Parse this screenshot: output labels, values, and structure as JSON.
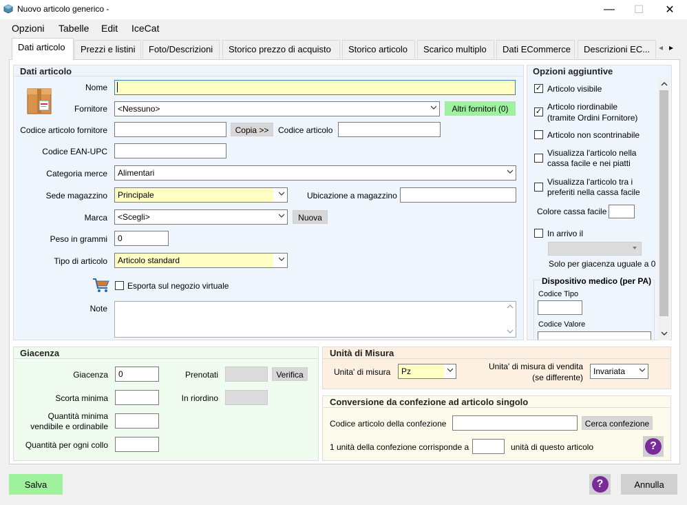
{
  "window": {
    "title": "Nuovo articolo generico -",
    "minimize": "—",
    "maximize": "☐",
    "close": "✕"
  },
  "menu": [
    "Opzioni",
    "Tabelle",
    "Edit",
    "IceCat"
  ],
  "tabs": [
    "Dati articolo",
    "Prezzi e listini",
    "Foto/Descrizioni",
    "Storico prezzo di acquisto",
    "Storico articolo",
    "Scarico multiplo",
    "Dati ECommerce",
    "Descrizioni EC..."
  ],
  "tab_scroll": {
    "left": "◂",
    "right": "▸"
  },
  "dati": {
    "title": "Dati articolo",
    "nome_label": "Nome",
    "nome_value": "",
    "fornitore_label": "Fornitore",
    "fornitore_value": "<Nessuno>",
    "altri_fornitori": "Altri fornitori (0)",
    "codice_fornitore_label": "Codice articolo fornitore",
    "codice_fornitore_value": "",
    "copia": "Copia >>",
    "codice_articolo_label": "Codice articolo",
    "codice_articolo_value": "",
    "ean_label": "Codice EAN-UPC",
    "ean_value": "",
    "categoria_label": "Categoria merce",
    "categoria_value": "Alimentari",
    "sede_label": "Sede magazzino",
    "sede_value": "Principale",
    "ubicazione_label": "Ubicazione a magazzino",
    "ubicazione_value": "",
    "marca_label": "Marca",
    "marca_value": "<Scegli>",
    "nuova": "Nuova",
    "peso_label": "Peso in grammi",
    "peso_value": "0",
    "tipo_label": "Tipo di articolo",
    "tipo_value": "Articolo standard",
    "esporta_label": "Esporta sul negozio virtuale",
    "note_label": "Note",
    "note_value": ""
  },
  "opzioni": {
    "title": "Opzioni aggiuntive",
    "articolo_visibile": "Articolo visibile",
    "riordinabile_1": "Articolo riordinabile",
    "riordinabile_2": "(tramite Ordini Fornitore)",
    "non_scontrinabile": "Articolo non scontrinabile",
    "cassa_facile_1": "Visualizza l'articolo nella",
    "cassa_facile_2": "cassa facile e nei piatti",
    "preferiti_1": "Visualizza l'articolo tra i",
    "preferiti_2": "preferiti nella cassa facile",
    "colore_label": "Colore cassa facile",
    "in_arrivo_label": "In arrivo il",
    "solo_giacenza": "Solo per giacenza uguale a 0",
    "dispositivo_title": "Dispositivo medico (per PA)",
    "codice_tipo_label": "Codice Tipo",
    "codice_valore_label": "Codice Valore",
    "checks": {
      "articolo_visibile": true,
      "riordinabile": true,
      "non_scontrinabile": false,
      "cassa_facile": false,
      "preferiti": false,
      "in_arrivo": false
    }
  },
  "giacenza": {
    "title": "Giacenza",
    "giacenza_label": "Giacenza",
    "giacenza_value": "0",
    "prenotati_label": "Prenotati",
    "verifica": "Verifica",
    "scorta_label": "Scorta minima",
    "riordino_label": "In riordino",
    "qmin_1": "Quantità minima",
    "qmin_2": "vendibile e ordinabile",
    "qcollo_label": "Quantità per ogni collo"
  },
  "unita": {
    "title": "Unità di Misura",
    "misura_label": "Unita' di misura",
    "misura_value": "Pz",
    "vendita_1": "Unita' di misura di vendita",
    "vendita_2": "(se differente)",
    "vendita_value": "Invariata"
  },
  "conversione": {
    "title": "Conversione da confezione ad articolo singolo",
    "codice_label": "Codice articolo della confezione",
    "cerca": "Cerca confezione",
    "corrisponde_label": "1 unità della confezione corrisponde a",
    "unita_label": "unità di questo articolo"
  },
  "footer": {
    "salva": "Salva",
    "annulla": "Annulla",
    "help": "?"
  },
  "colors": {
    "yellow_field": "#ffffc4",
    "green_button": "#9ef29e",
    "blue_panel": "#eef5fc",
    "green_panel": "#f0fcf0",
    "orange_panel": "#fdf0e0",
    "help_purple": "#7b2a9a"
  }
}
